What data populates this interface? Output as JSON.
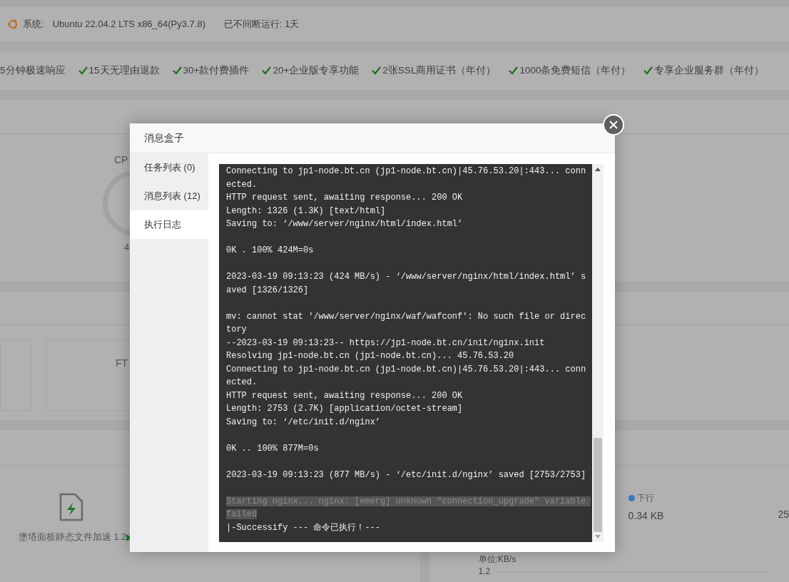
{
  "system": {
    "label": "系统:",
    "value": "Ubuntu 22.04.2 LTS x86_64(Py3.7.8)",
    "uptime": "已不间断运行: 1天"
  },
  "features": [
    "5分钟极速响应",
    "15天无理由退款",
    "30+款付费插件",
    "20+企业版专享功能",
    "2张SSL商用证书（年付）",
    "1000条免费短信（年付）",
    "专享企业服务群（年付）"
  ],
  "status": {
    "cpu_label": "CP",
    "cpu_sub": "4"
  },
  "overview": {
    "ftp_label": "FT"
  },
  "software": {
    "plugin_name": "堡塔面板静态文件加速 1.2",
    "plugin_arrow": "▶"
  },
  "traffic": {
    "legend": "下行",
    "value": "0.34 KB",
    "value_2": "25",
    "unit": "单位:KB/s",
    "ytick": "1.2"
  },
  "modal": {
    "title": "消息盒子",
    "tabs": [
      {
        "label": "任务列表 (0)",
        "selected": false
      },
      {
        "label": "消息列表 (12)",
        "selected": false
      },
      {
        "label": "执行日志",
        "selected": true
      }
    ],
    "log": [
      {
        "kind": "text",
        "text": "Connecting to jp1-node.bt.cn (jp1-node.bt.cn)|45.76.53.20|:443... connected."
      },
      {
        "kind": "text",
        "text": "HTTP request sent, awaiting response... 200 OK"
      },
      {
        "kind": "text",
        "text": "Length: 1326 (1.3K) [text/html]"
      },
      {
        "kind": "text",
        "text": "Saving to: ‘/www/server/nginx/html/index.html’"
      },
      {
        "kind": "blank"
      },
      {
        "kind": "text",
        "text": "0K . 100% 424M=0s"
      },
      {
        "kind": "blank"
      },
      {
        "kind": "text",
        "text": "2023-03-19 09:13:23 (424 MB/s) - ‘/www/server/nginx/html/index.html’ saved [1326/1326]"
      },
      {
        "kind": "blank"
      },
      {
        "kind": "text",
        "text": "mv: cannot stat '/www/server/nginx/waf/wafconf': No such file or directory"
      },
      {
        "kind": "text",
        "text": "--2023-03-19 09:13:23-- https://jp1-node.bt.cn/init/nginx.init"
      },
      {
        "kind": "text",
        "text": "Resolving jp1-node.bt.cn (jp1-node.bt.cn)... 45.76.53.20"
      },
      {
        "kind": "text",
        "text": "Connecting to jp1-node.bt.cn (jp1-node.bt.cn)|45.76.53.20|:443... connected."
      },
      {
        "kind": "text",
        "text": "HTTP request sent, awaiting response... 200 OK"
      },
      {
        "kind": "text",
        "text": "Length: 2753 (2.7K) [application/octet-stream]"
      },
      {
        "kind": "text",
        "text": "Saving to: ‘/etc/init.d/nginx’"
      },
      {
        "kind": "blank"
      },
      {
        "kind": "text",
        "text": "0K .. 100% 877M=0s"
      },
      {
        "kind": "blank"
      },
      {
        "kind": "text",
        "text": "2023-03-19 09:13:23 (877 MB/s) - ‘/etc/init.d/nginx’ saved [2753/2753]"
      },
      {
        "kind": "blank"
      },
      {
        "kind": "selected",
        "text": "Starting nginx... nginx: [emerg] unknown \"connection_upgrade\" variable failed"
      },
      {
        "kind": "text",
        "text": "|-Successify --- 命令已执行！---"
      }
    ]
  }
}
